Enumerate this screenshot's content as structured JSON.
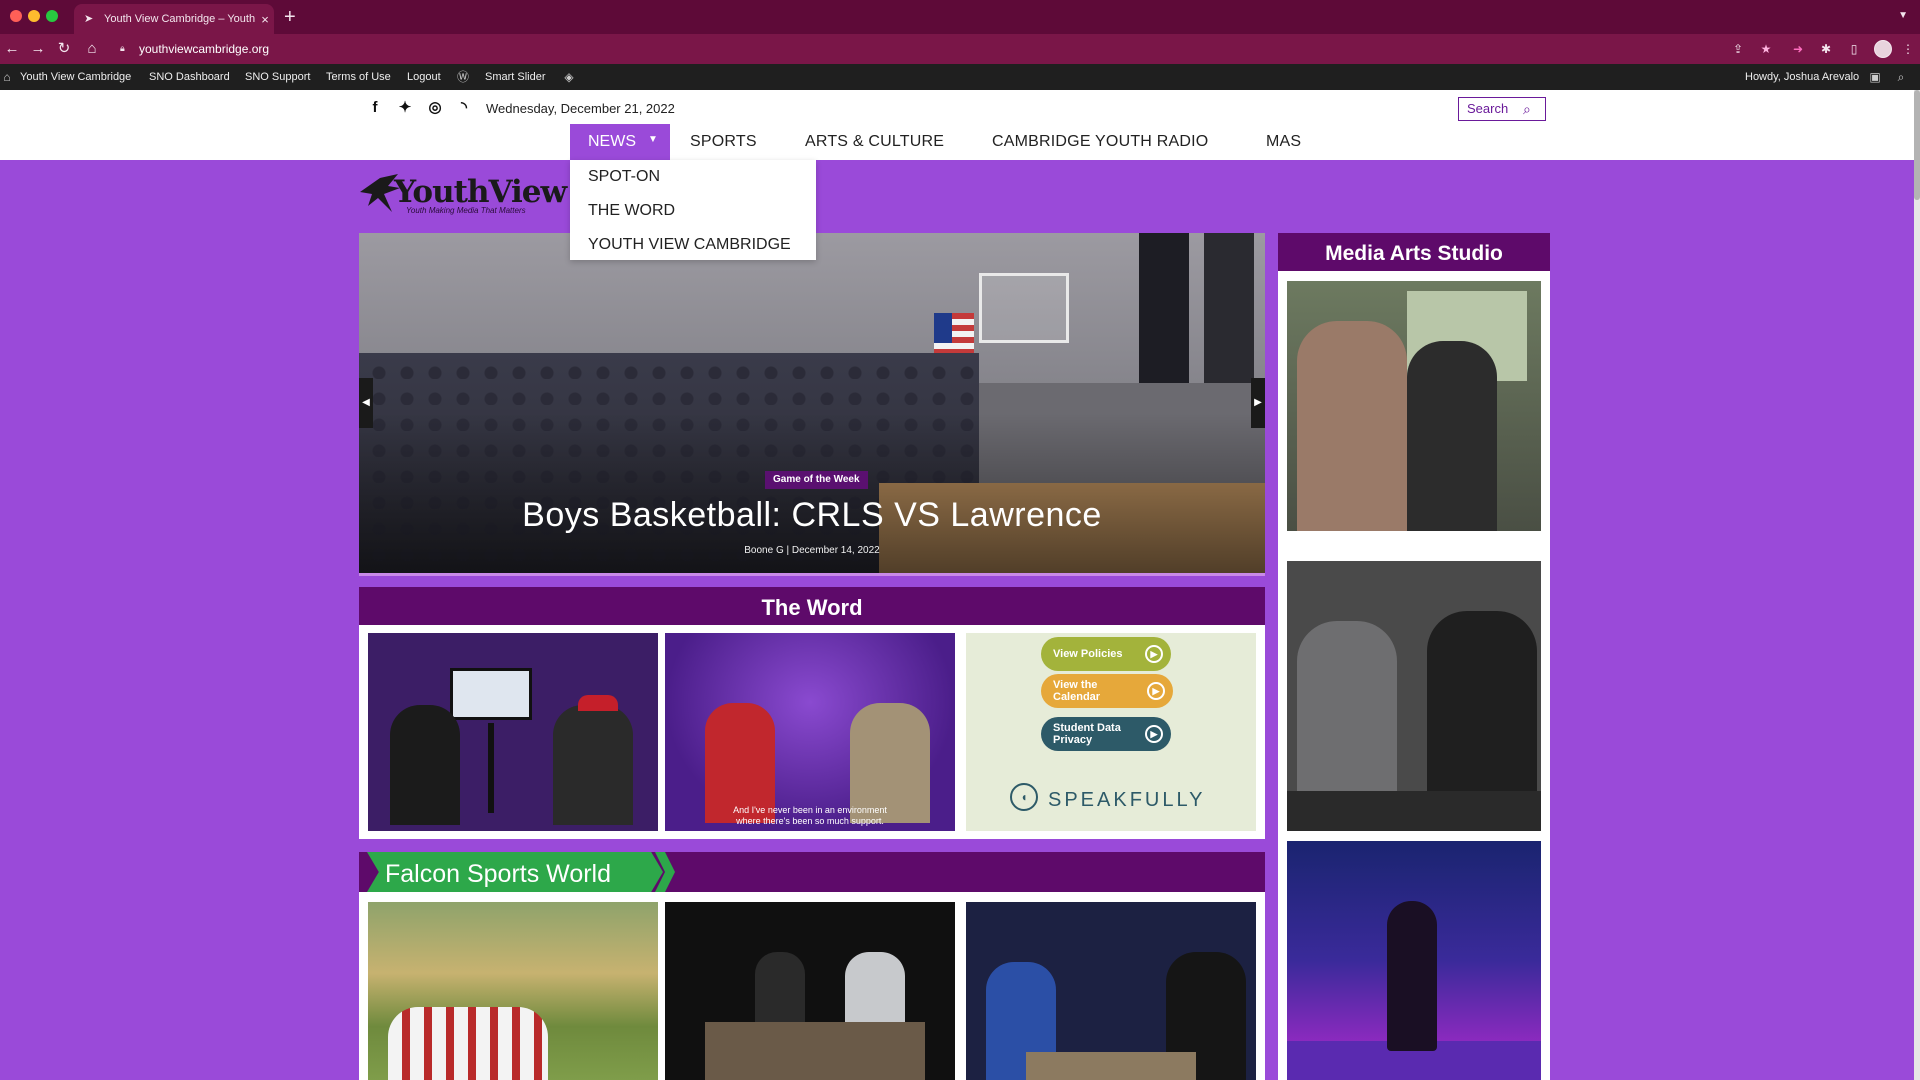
{
  "browser": {
    "tab_title": "Youth View Cambridge – Youth",
    "url": "youthviewcambridge.org",
    "accent": "#5e0a38"
  },
  "admin_bar": {
    "items": [
      "Youth View Cambridge",
      "SNO Dashboard",
      "SNO Support",
      "Terms of Use",
      "Logout",
      "Smart Slider"
    ],
    "greeting": "Howdy, Joshua Arevalo"
  },
  "header": {
    "date": "Wednesday, December 21, 2022",
    "search_label": "Search",
    "social_icons": [
      "facebook-icon",
      "twitter-icon",
      "instagram-icon",
      "rss-icon"
    ]
  },
  "nav": {
    "items": [
      "NEWS",
      "SPORTS",
      "ARTS & CULTURE",
      "CAMBRIDGE YOUTH RADIO",
      "MAS"
    ],
    "dropdown": [
      "SPOT-ON",
      "THE WORD",
      "YOUTH VIEW CAMBRIDGE"
    ]
  },
  "logo": {
    "text": "YouthView",
    "tagline": "Youth Making Media That Matters"
  },
  "hero": {
    "category": "Game of the Week",
    "title": "Boys Basketball: CRLS VS Lawrence",
    "byline": "Boone G | December 14, 2022"
  },
  "the_word": {
    "title": "The Word",
    "caption_line1": "And I've never been in an environment",
    "caption_line2": "where there's been so much support.",
    "speakfully": {
      "buttons": [
        {
          "label": "View Policies",
          "color": "#a3b33b"
        },
        {
          "label": "View the Calendar",
          "color": "#e6a83a"
        },
        {
          "label": "Student Data Privacy",
          "color": "#2d5a68"
        }
      ],
      "brand": "SPEAKFULLY"
    }
  },
  "sports": {
    "title": "Falcon Sports World",
    "accent": "#2da84a"
  },
  "sidebar": {
    "title": "Media Arts Studio"
  },
  "colors": {
    "page_bg": "#9a4ad9",
    "section_header": "#5e0a6a"
  }
}
